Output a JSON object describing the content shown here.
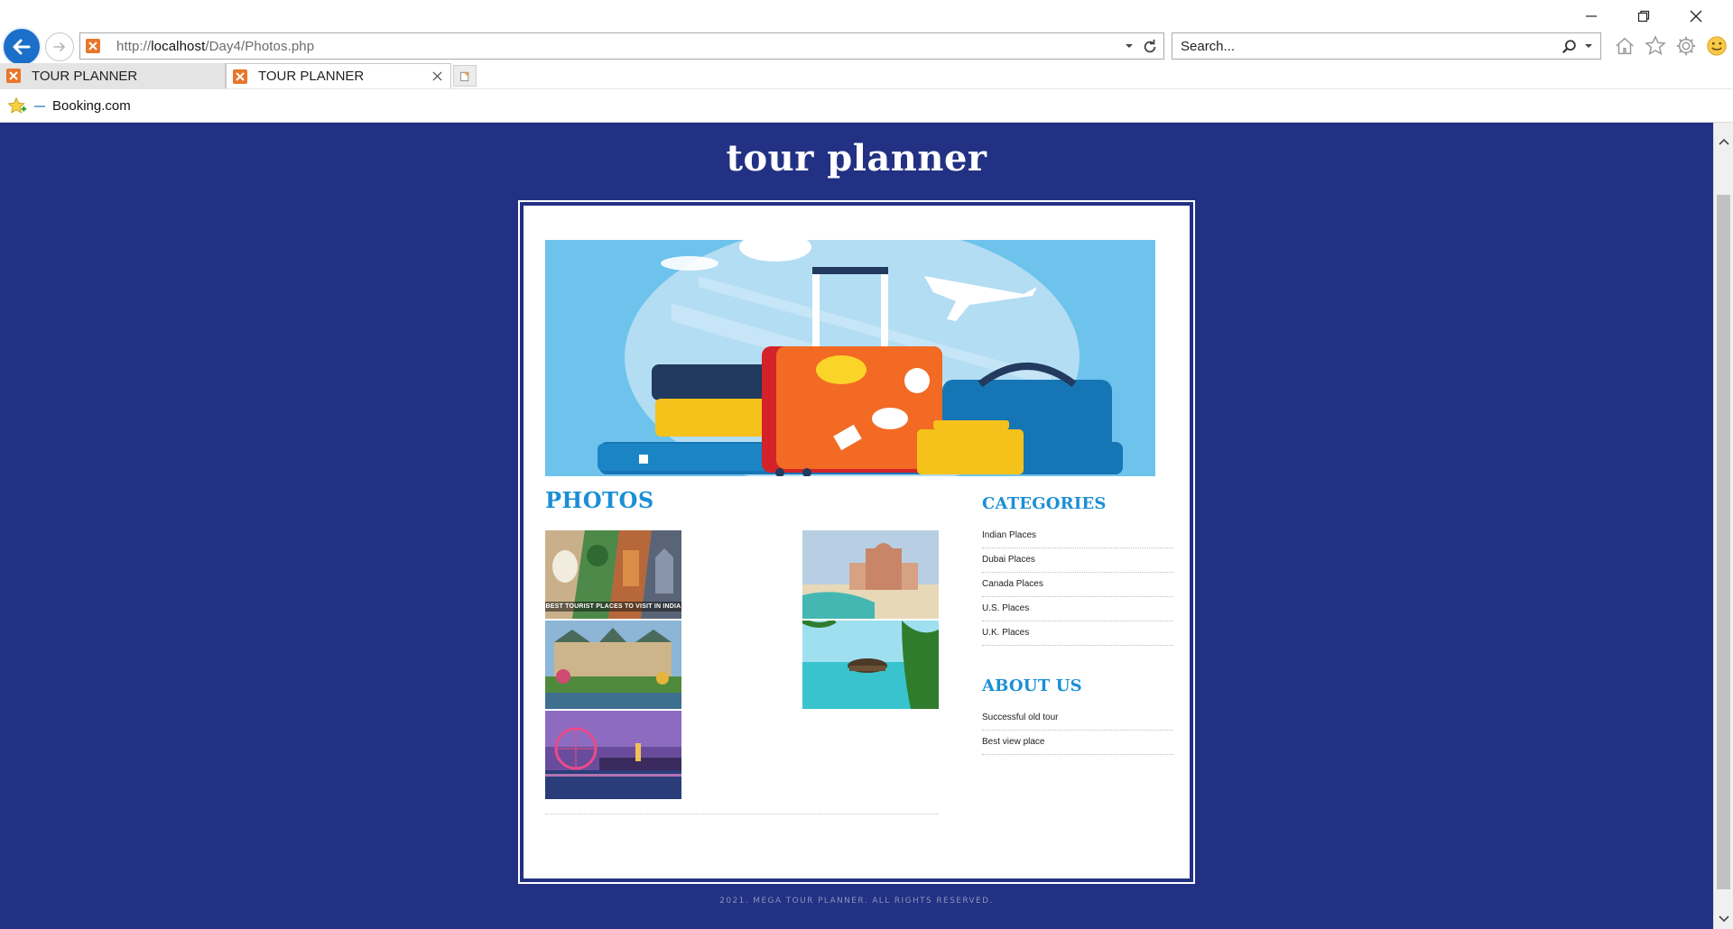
{
  "browser": {
    "url_prefix": "http://",
    "url_host": "localhost",
    "url_path": "/Day4/Photos.php",
    "search_placeholder": "Search...",
    "tabs": [
      {
        "label": "TOUR PLANNER",
        "active": false
      },
      {
        "label": "TOUR PLANNER",
        "active": true
      }
    ],
    "favorites": [
      {
        "label": "Booking.com"
      }
    ],
    "accent_color": "#1b6fc9"
  },
  "page": {
    "site_title": "tour planner",
    "background_color": "#223183",
    "heading_color": "#1b8fd6",
    "photos_heading": "PHOTOS",
    "photos": [
      {
        "name": "india",
        "caption": "BEST TOURIST PLACES TO VISIT IN INDIA"
      },
      {
        "name": "dubai",
        "caption": ""
      },
      {
        "name": "canada",
        "caption": ""
      },
      {
        "name": "maldives",
        "caption": ""
      },
      {
        "name": "london",
        "caption": ""
      }
    ],
    "categories_heading": "CATEGORIES",
    "categories": [
      "Indian Places",
      "Dubai Places",
      "Canada Places",
      "U.S. Places",
      "U.K. Places"
    ],
    "about_heading": "ABOUT US",
    "about_links": [
      "Successful old tour",
      "Best view place"
    ],
    "footer": "2021. MEGA TOUR PLANNER. ALL RIGHTS RESERVED."
  }
}
